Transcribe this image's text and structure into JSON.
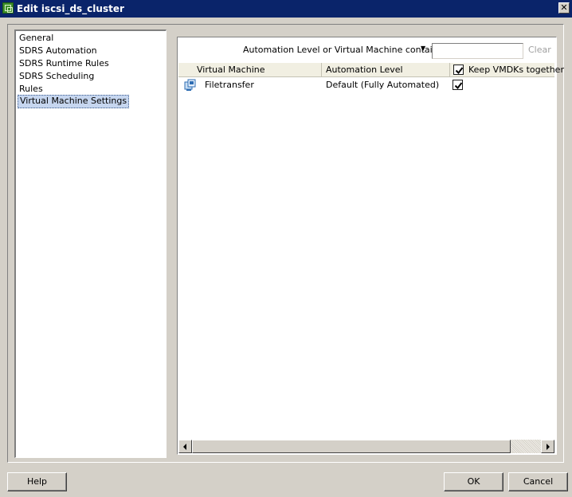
{
  "window": {
    "title": "Edit iscsi_ds_cluster",
    "close_glyph": "✕"
  },
  "nav": {
    "items": [
      {
        "label": "General"
      },
      {
        "label": "SDRS Automation"
      },
      {
        "label": "SDRS Runtime Rules"
      },
      {
        "label": "SDRS Scheduling"
      },
      {
        "label": "Rules"
      },
      {
        "label": "Virtual Machine Settings",
        "selected": true
      }
    ]
  },
  "filter": {
    "label": "Automation Level or Virtual Machine contains:",
    "dropdown_icon": "chevron-down-icon",
    "value": "",
    "clear_label": "Clear"
  },
  "table": {
    "columns": [
      "Virtual Machine",
      "Automation Level",
      "Keep VMDKs together"
    ],
    "header_checkbox_checked": true,
    "rows": [
      {
        "vm_icon": "vm-icon",
        "name": "Filetransfer",
        "automation_level": "Default (Fully Automated)",
        "keep_together": true
      }
    ]
  },
  "buttons": {
    "help": "Help",
    "ok": "OK",
    "cancel": "Cancel"
  },
  "colors": {
    "titlebar": "#0a246a",
    "dialog_bg": "#d4d0c8",
    "selection": "#c6d6ef"
  }
}
